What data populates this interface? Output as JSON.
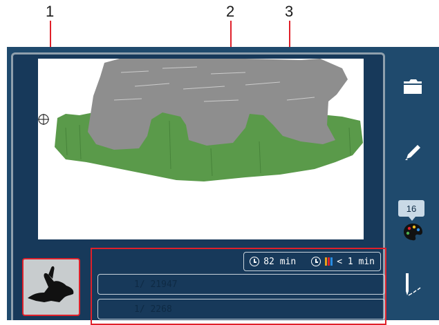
{
  "callouts": [
    "1",
    "2",
    "3"
  ],
  "info": {
    "stitch_time": "82 min",
    "color_change_time": "< 1 min",
    "stitch_counter": "1/ 21947",
    "color_counter": "1/  2268"
  },
  "sidebar": {
    "color_count": "16"
  },
  "colors": {
    "frame": "#1f4a6d",
    "screen": "#17395a",
    "highlight": "#e0202a",
    "grass": "#5a9a4a",
    "bear": "#8e8e8e"
  },
  "icons": [
    "folder-icon",
    "pencil-icon",
    "color-palette-icon",
    "needle-icon",
    "rabbit-icon",
    "clock-icon",
    "color-bars-icon",
    "crosshair-icon"
  ]
}
